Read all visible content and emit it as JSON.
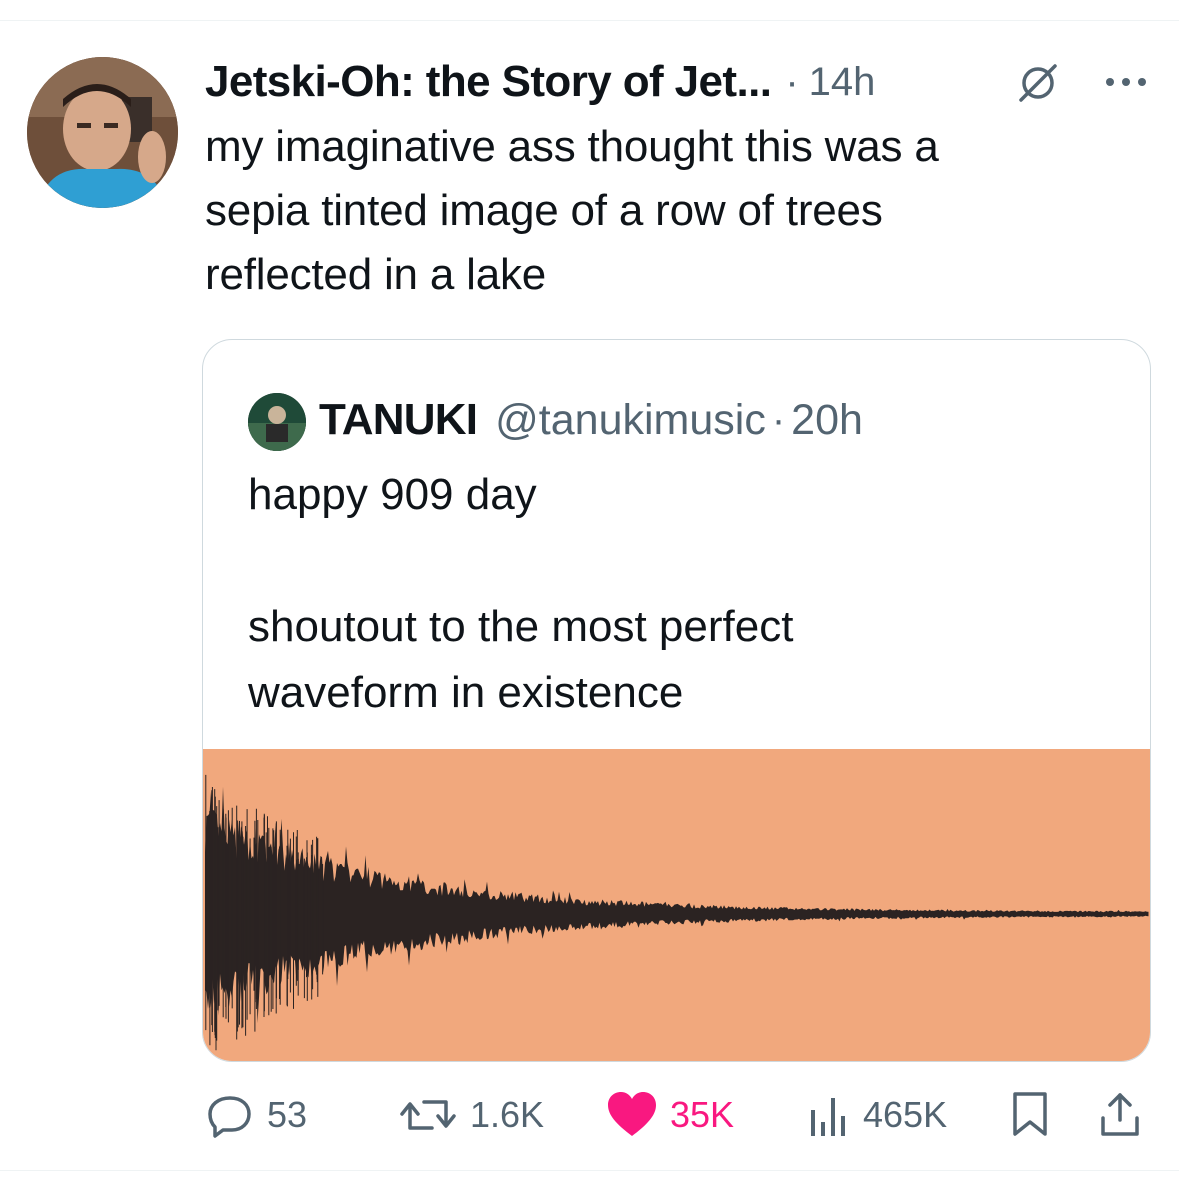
{
  "tweet": {
    "author_name": "JetskiOh: the Story of Jet...",
    "author_name_display": "Jetski-Oh: the Story of Jet...",
    "separator": "·",
    "time": "14h",
    "text": "my imaginative ass thought this was a\nsepia tinted image of a row of trees\nreflected in a lake"
  },
  "quote": {
    "name": "TANUKI",
    "handle": "@tanukimusic",
    "separator": "·",
    "time": "20h",
    "text": "happy 909 day\n\nshoutout to the most perfect\nwaveform in existence",
    "media_colors": {
      "background": "#f1a87d",
      "waveform": "#2b2322"
    }
  },
  "actions": {
    "replies": "53",
    "reposts": "1.6K",
    "likes": "35K",
    "views": "465K"
  },
  "colors": {
    "text": "#0f1419",
    "secondary": "#536471",
    "like": "#f91880",
    "border": "#cfd9de"
  }
}
